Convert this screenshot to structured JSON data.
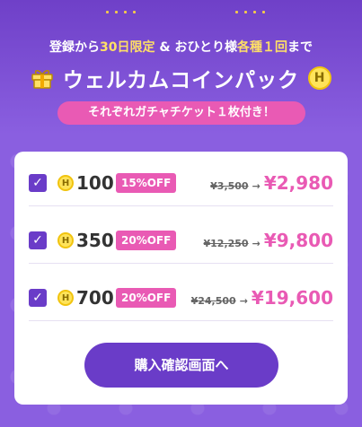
{
  "header": {
    "line1_prefix": "登録から",
    "line1_hl1": "30日限定",
    "line1_mid": " & おひとり様",
    "line1_hl2": "各種１回",
    "line1_suffix": "まで",
    "title": "ウェルカムコインパック",
    "pill": "それぞれガチャチケット１枚付き！",
    "coin_symbol": "H"
  },
  "packs": [
    {
      "qty": "100",
      "badge": "15%OFF",
      "old_price": "¥3,500",
      "arrow": "→",
      "new_price": "¥2,980"
    },
    {
      "qty": "350",
      "badge": "20%OFF",
      "old_price": "¥12,250",
      "arrow": "→",
      "new_price": "¥9,800"
    },
    {
      "qty": "700",
      "badge": "20%OFF",
      "old_price": "¥24,500",
      "arrow": "→",
      "new_price": "¥19,600"
    }
  ],
  "check_mark": "✓",
  "cta_label": "購入確認画面へ",
  "colors": {
    "accent": "#6a3cc8",
    "pink": "#e95ab4",
    "background": "#8a5fe0",
    "highlight": "#ffe066"
  }
}
